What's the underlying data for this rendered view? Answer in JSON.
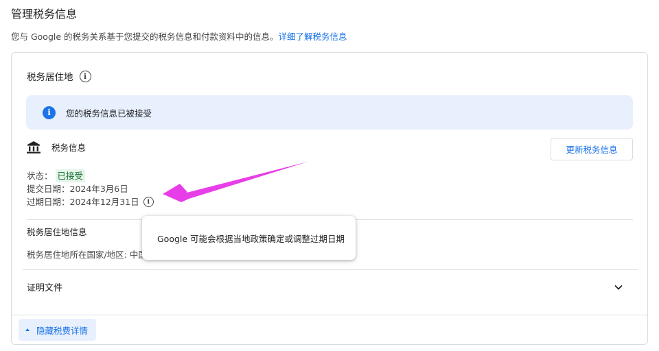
{
  "header": {
    "title": "管理税务信息",
    "subtitle": "您与 Google 的税务关系基于您提交的税务信息和付款资料中的信息。",
    "learn_more_link": "详细了解税务信息"
  },
  "card": {
    "section_title": "税务居住地",
    "banner": {
      "text": "您的税务信息已被接受"
    },
    "tax_info": {
      "label": "税务信息",
      "update_button": "更新税务信息",
      "status_label": "状态：",
      "status_value": "已接受",
      "submit_date_label": "提交日期：",
      "submit_date_value": "2024年3月6日",
      "expire_date_label": "过期日期：",
      "expire_date_value": "2024年12月31日"
    },
    "residence": {
      "heading": "税务居住地信息",
      "country_label": "税务居住地所在国家/地区: ",
      "country_value": "中国"
    },
    "documents": {
      "label": "证明文件"
    },
    "hide_details_button": "隐藏税费详情"
  },
  "tooltip": {
    "text": "Google 可能会根据当地政策确定或调整过期日期"
  },
  "colors": {
    "accent": "#1a73e8",
    "banner_bg": "#e8f0fe",
    "success_bg": "#e6f4ea",
    "success_text": "#137333",
    "annotation_arrow": "#e83ee8"
  },
  "icons": {
    "section_info": "info-outline-icon",
    "banner": "info-filled-icon",
    "tax_info": "bank-icon",
    "expire_info": "info-outline-icon",
    "documents_toggle": "chevron-down-icon",
    "hide_button": "caret-up-icon"
  }
}
